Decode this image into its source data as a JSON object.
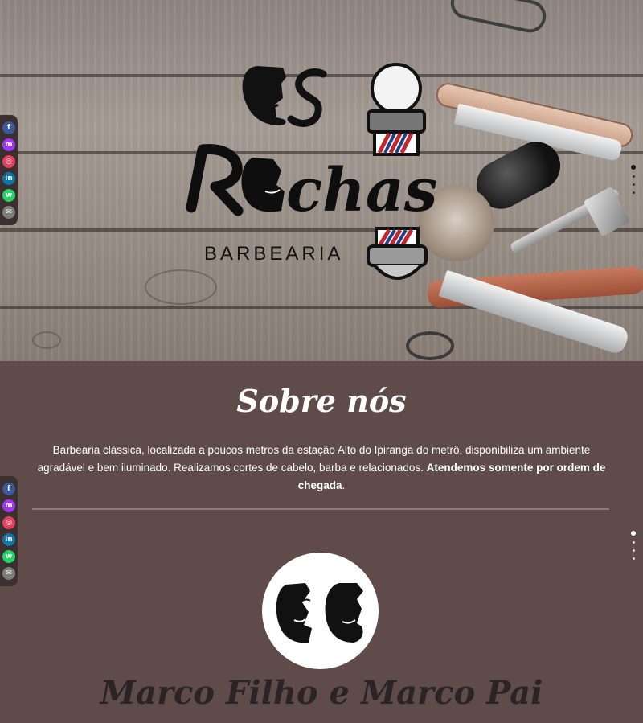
{
  "hero": {
    "logo_text_top": "Os",
    "logo_text_main": "Rochas",
    "logo_subtitle": "BARBEARIA"
  },
  "social_links": [
    {
      "name": "facebook",
      "glyph": "f",
      "color": "#3b5998",
      "icon": "facebook-icon"
    },
    {
      "name": "messenger",
      "glyph": "m",
      "color": "#a334fa",
      "icon": "messenger-icon"
    },
    {
      "name": "instagram",
      "glyph": "◎",
      "color": "#e4405f",
      "icon": "instagram-icon"
    },
    {
      "name": "linkedin",
      "glyph": "in",
      "color": "#0e76a8",
      "icon": "linkedin-icon"
    },
    {
      "name": "whatsapp",
      "glyph": "w",
      "color": "#25d366",
      "icon": "whatsapp-icon"
    },
    {
      "name": "email",
      "glyph": "✉",
      "color": "#7d7d7d",
      "icon": "email-icon"
    }
  ],
  "about": {
    "title": "Sobre nós",
    "text": "Barbearia clássica, localizada a poucos metros da estação Alto do Ipiranga do metrô, disponibiliza um ambiente agradável e bem iluminado. Realizamos cortes de cabelo, barba e relacionados. ",
    "text_bold": "Atendemos somente por ordem de chegada",
    "text_end": ".",
    "team_name": "Marco Filho e Marco Pai"
  },
  "colors": {
    "section_bg": "#5f4c4a",
    "title_text": "#ffffff",
    "name_text": "#2a2426"
  }
}
